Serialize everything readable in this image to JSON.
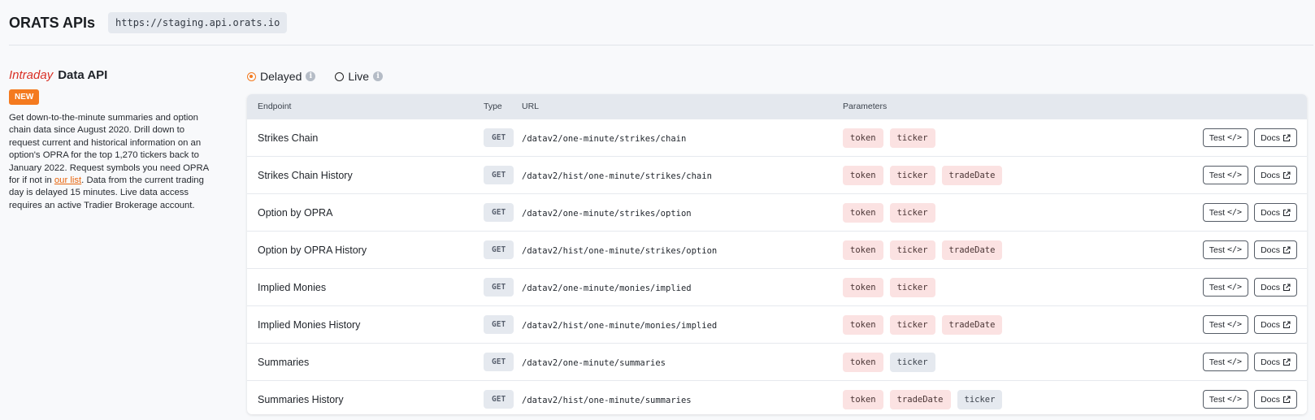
{
  "header": {
    "title": "ORATS APIs",
    "base_url": "https://staging.api.orats.io"
  },
  "api": {
    "title_highlight": "Intraday",
    "title_rest": "Data API",
    "badge": "NEW",
    "desc_before_link": "Get down-to-the-minute summaries and option chain data since August 2020. Drill down to request current and historical information on an option's OPRA for the top 1,270 tickers back to January 2022. Request symbols you need OPRA for if not in ",
    "desc_link": "our list",
    "desc_after_link": ". Data from the current trading day is delayed 15 minutes. Live data access requires an active Tradier Brokerage account."
  },
  "mode": {
    "options": [
      {
        "label": "Delayed",
        "selected": true
      },
      {
        "label": "Live",
        "selected": false
      }
    ]
  },
  "table": {
    "headers": {
      "endpoint": "Endpoint",
      "type": "Type",
      "url": "URL",
      "params": "Parameters"
    },
    "test_label": "Test",
    "docs_label": "Docs",
    "rows": [
      {
        "endpoint": "Strikes Chain",
        "method": "GET",
        "url": "/datav2/one-minute/strikes/chain",
        "params": [
          {
            "name": "token",
            "req": true
          },
          {
            "name": "ticker",
            "req": true
          }
        ]
      },
      {
        "endpoint": "Strikes Chain History",
        "method": "GET",
        "url": "/datav2/hist/one-minute/strikes/chain",
        "params": [
          {
            "name": "token",
            "req": true
          },
          {
            "name": "ticker",
            "req": true
          },
          {
            "name": "tradeDate",
            "req": true
          }
        ]
      },
      {
        "endpoint": "Option by OPRA",
        "method": "GET",
        "url": "/datav2/one-minute/strikes/option",
        "params": [
          {
            "name": "token",
            "req": true
          },
          {
            "name": "ticker",
            "req": true
          }
        ]
      },
      {
        "endpoint": "Option by OPRA History",
        "method": "GET",
        "url": "/datav2/hist/one-minute/strikes/option",
        "params": [
          {
            "name": "token",
            "req": true
          },
          {
            "name": "ticker",
            "req": true
          },
          {
            "name": "tradeDate",
            "req": true
          }
        ]
      },
      {
        "endpoint": "Implied Monies",
        "method": "GET",
        "url": "/datav2/one-minute/monies/implied",
        "params": [
          {
            "name": "token",
            "req": true
          },
          {
            "name": "ticker",
            "req": true
          }
        ]
      },
      {
        "endpoint": "Implied Monies History",
        "method": "GET",
        "url": "/datav2/hist/one-minute/monies/implied",
        "params": [
          {
            "name": "token",
            "req": true
          },
          {
            "name": "ticker",
            "req": true
          },
          {
            "name": "tradeDate",
            "req": true
          }
        ]
      },
      {
        "endpoint": "Summaries",
        "method": "GET",
        "url": "/datav2/one-minute/summaries",
        "params": [
          {
            "name": "token",
            "req": true
          },
          {
            "name": "ticker",
            "req": false
          }
        ]
      },
      {
        "endpoint": "Summaries History",
        "method": "GET",
        "url": "/datav2/hist/one-minute/summaries",
        "params": [
          {
            "name": "token",
            "req": true
          },
          {
            "name": "tradeDate",
            "req": true
          },
          {
            "name": "ticker",
            "req": false
          }
        ]
      }
    ]
  },
  "colors": {
    "accent": "#f47a1f",
    "required_param_bg": "#fbe2e2",
    "optional_param_bg": "#e5e9ef",
    "highlight_text": "#d93025"
  }
}
